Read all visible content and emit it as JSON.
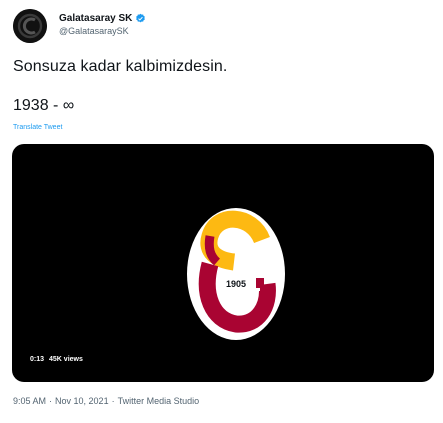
{
  "tweet": {
    "author": {
      "display_name": "Galatasaray SK",
      "handle": "@GalatasaraySK",
      "avatar_icon": "galatasaray-crest",
      "verified_icon": "verified-badge-icon"
    },
    "text_line1": "Sonsuza kadar kalbimizdesin.",
    "text_line2": "1938 - ∞",
    "translate_label": "Translate Tweet",
    "media": {
      "logo_year": "1905",
      "duration": "0:13",
      "views": "45K views"
    },
    "meta": {
      "time": "9:05 AM",
      "separator": "·",
      "date": "Nov 10, 2021",
      "source": "Twitter Media Studio"
    }
  },
  "colors": {
    "brand_red": "#a90432",
    "brand_yellow": "#fdb912",
    "link_blue": "#1d9bf0",
    "secondary_text": "#536471"
  }
}
